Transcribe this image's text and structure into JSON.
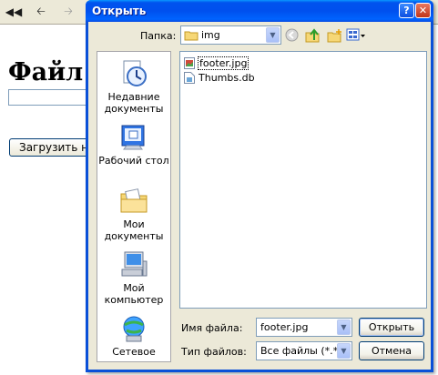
{
  "browser": {
    "heading": "Файл",
    "upload_button_label": "Загрузить на"
  },
  "dialog": {
    "title": "Открыть",
    "look_in_label": "Папка:",
    "look_in_value": "img",
    "places": [
      {
        "label": "Недавние документы",
        "icon": "recent-documents-icon"
      },
      {
        "label": "Рабочий стол",
        "icon": "desktop-icon"
      },
      {
        "label": "Мои документы",
        "icon": "my-documents-icon"
      },
      {
        "label": "Мой компьютер",
        "icon": "my-computer-icon"
      },
      {
        "label": "Сетевое",
        "icon": "network-icon"
      }
    ],
    "files": [
      {
        "name": "footer.jpg",
        "icon": "image-file-icon",
        "selected": true
      },
      {
        "name": "Thumbs.db",
        "icon": "db-file-icon",
        "selected": false
      }
    ],
    "filename_label": "Имя файла:",
    "filename_value": "footer.jpg",
    "filetype_label": "Тип файлов:",
    "filetype_value": "Все файлы (*.*)",
    "open_button": "Открыть",
    "cancel_button": "Отмена"
  },
  "colors": {
    "titlebar": "#0053ee",
    "dialog_face": "#ece9d8",
    "field_border": "#7f9db9"
  }
}
